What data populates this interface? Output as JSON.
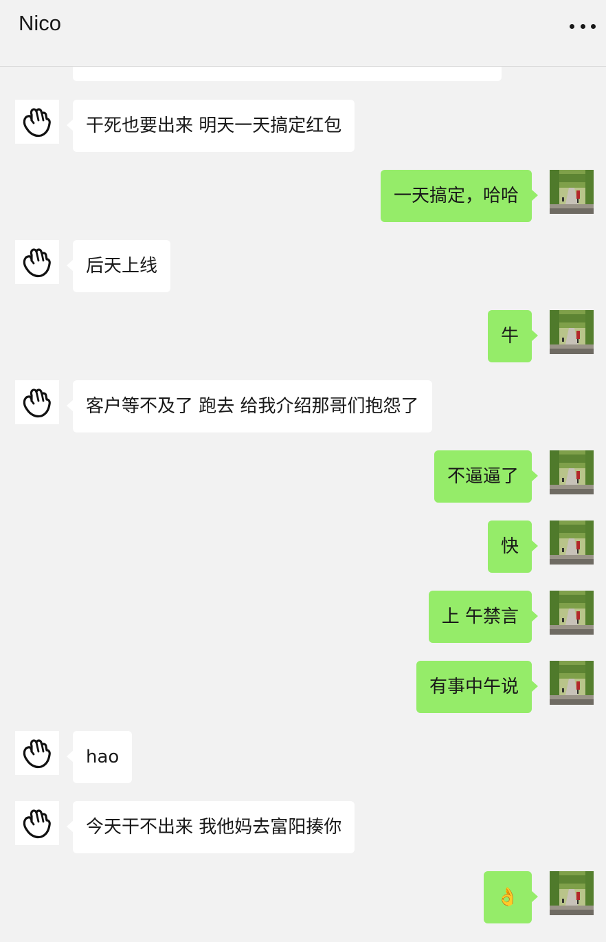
{
  "header": {
    "title": "Nico",
    "more_icon": "more-dots-icon"
  },
  "contact": {
    "avatar_icon": "hand-doodle-icon"
  },
  "me": {
    "avatar_image": "park-path-photo"
  },
  "messages": [
    {
      "side": "left",
      "text": "干死也要出来 明天一天搞定红包"
    },
    {
      "side": "right",
      "text": "一天搞定，哈哈"
    },
    {
      "side": "left",
      "text": "后天上线"
    },
    {
      "side": "right",
      "text": "牛"
    },
    {
      "side": "left",
      "text": "客户等不及了 跑去 给我介绍那哥们抱怨了"
    },
    {
      "side": "right",
      "text": "不逼逼了"
    },
    {
      "side": "right",
      "text": "快"
    },
    {
      "side": "right",
      "text": "上 午禁言"
    },
    {
      "side": "right",
      "text": "有事中午说"
    },
    {
      "side": "left",
      "text": "hao"
    },
    {
      "side": "left",
      "text": "今天干不出来 我他妈去富阳揍你"
    },
    {
      "side": "right",
      "text": "👌",
      "emoji": "ok-hand"
    }
  ],
  "colors": {
    "background": "#f2f2f2",
    "incoming_bubble": "#ffffff",
    "outgoing_bubble": "#95ec69",
    "text": "#191919"
  }
}
